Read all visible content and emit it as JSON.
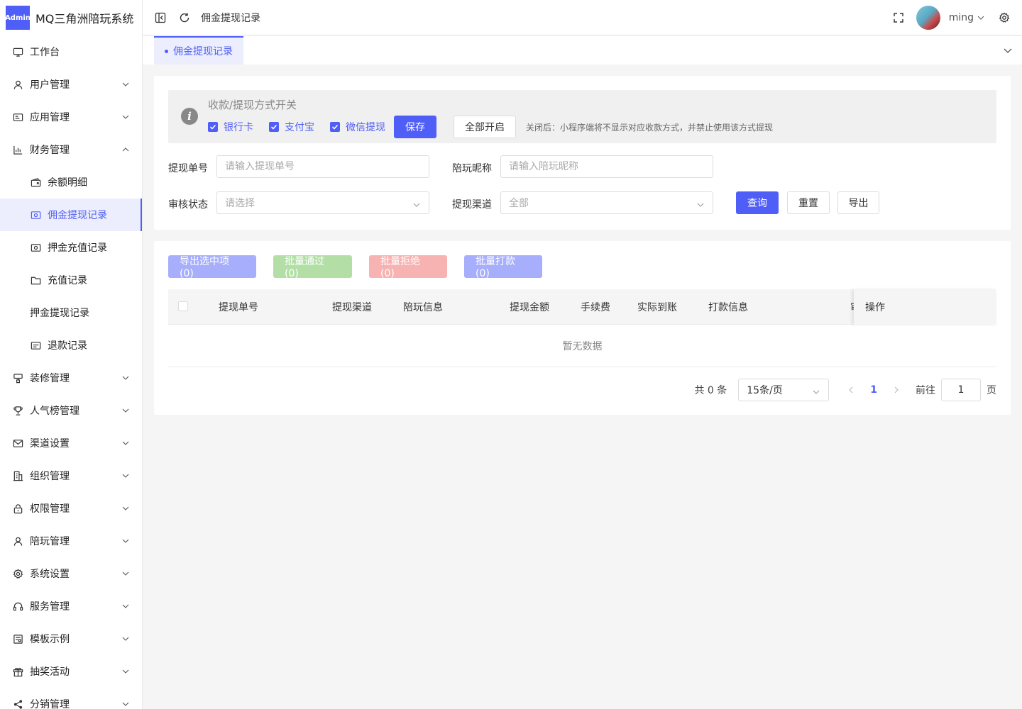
{
  "app": {
    "logo_badge": "Admin",
    "title": "MQ三角洲陪玩系统"
  },
  "sidebar": {
    "items": [
      {
        "label": "工作台",
        "icon": "monitor-icon",
        "arrow": ""
      },
      {
        "label": "用户管理",
        "icon": "user-icon",
        "arrow": "down"
      },
      {
        "label": "应用管理",
        "icon": "app-icon",
        "arrow": "down"
      },
      {
        "label": "财务管理",
        "icon": "chart-icon",
        "arrow": "up"
      },
      {
        "label": "余额明细",
        "icon": "wallet-icon",
        "arrow": "",
        "sub": true
      },
      {
        "label": "佣金提现记录",
        "icon": "money-icon",
        "arrow": "",
        "sub": true,
        "active": true
      },
      {
        "label": "押金充值记录",
        "icon": "money-icon",
        "arrow": "",
        "sub": true
      },
      {
        "label": "充值记录",
        "icon": "folder-icon",
        "arrow": "",
        "sub": true
      },
      {
        "label": "押金提现记录",
        "icon": "",
        "arrow": "",
        "sub": true
      },
      {
        "label": "退款记录",
        "icon": "card-icon",
        "arrow": "",
        "sub": true
      },
      {
        "label": "装修管理",
        "icon": "brush-icon",
        "arrow": "down"
      },
      {
        "label": "人气榜管理",
        "icon": "trophy-icon",
        "arrow": "down"
      },
      {
        "label": "渠道设置",
        "icon": "mail-icon",
        "arrow": "down"
      },
      {
        "label": "组织管理",
        "icon": "building-icon",
        "arrow": "down"
      },
      {
        "label": "权限管理",
        "icon": "lock-icon",
        "arrow": "down"
      },
      {
        "label": "陪玩管理",
        "icon": "user-icon",
        "arrow": "down"
      },
      {
        "label": "系统设置",
        "icon": "gear-icon",
        "arrow": "down"
      },
      {
        "label": "服务管理",
        "icon": "headset-icon",
        "arrow": "down"
      },
      {
        "label": "模板示例",
        "icon": "template-icon",
        "arrow": "down"
      },
      {
        "label": "抽奖活动",
        "icon": "gift-icon",
        "arrow": "down"
      },
      {
        "label": "分销管理",
        "icon": "share-icon",
        "arrow": "down"
      }
    ]
  },
  "header": {
    "breadcrumb": "佣金提现记录",
    "username": "ming"
  },
  "tabs": [
    {
      "label": "佣金提现记录"
    }
  ],
  "notice": {
    "title": "收款/提现方式开关",
    "options": [
      {
        "label": "银行卡",
        "checked": true
      },
      {
        "label": "支付宝",
        "checked": true
      },
      {
        "label": "微信提现",
        "checked": true
      }
    ],
    "save_label": "保存",
    "enable_all_label": "全部开启",
    "tip": "关闭后：小程序端将不显示对应收款方式，并禁止使用该方式提现"
  },
  "filters": {
    "order_no": {
      "label": "提现单号",
      "placeholder": "请输入提现单号"
    },
    "nickname": {
      "label": "陪玩昵称",
      "placeholder": "请输入陪玩昵称"
    },
    "status": {
      "label": "审核状态",
      "placeholder": "请选择"
    },
    "channel": {
      "label": "提现渠道",
      "value": "全部"
    },
    "query_label": "查询",
    "reset_label": "重置",
    "export_label": "导出"
  },
  "bulk_actions": [
    {
      "label": "导出选中项 (0)",
      "color": "#a7aefb"
    },
    {
      "label": "批量通过 (0)",
      "color": "#b3dfa6"
    },
    {
      "label": "批量拒绝 (0)",
      "color": "#f7b2b2"
    },
    {
      "label": "批量打款 (0)",
      "color": "#a7aefb"
    }
  ],
  "table": {
    "columns": [
      "提现单号",
      "提现渠道",
      "陪玩信息",
      "提现金额",
      "手续费",
      "实际到账",
      "打款信息",
      "审",
      "操作"
    ],
    "empty_text": "暂无数据"
  },
  "pagination": {
    "total_text": "共 0 条",
    "page_size": "15条/页",
    "current_page": "1",
    "goto_label": "前往",
    "goto_value": "1",
    "page_suffix": "页"
  },
  "colors": {
    "primary": "#4f5ef7"
  }
}
